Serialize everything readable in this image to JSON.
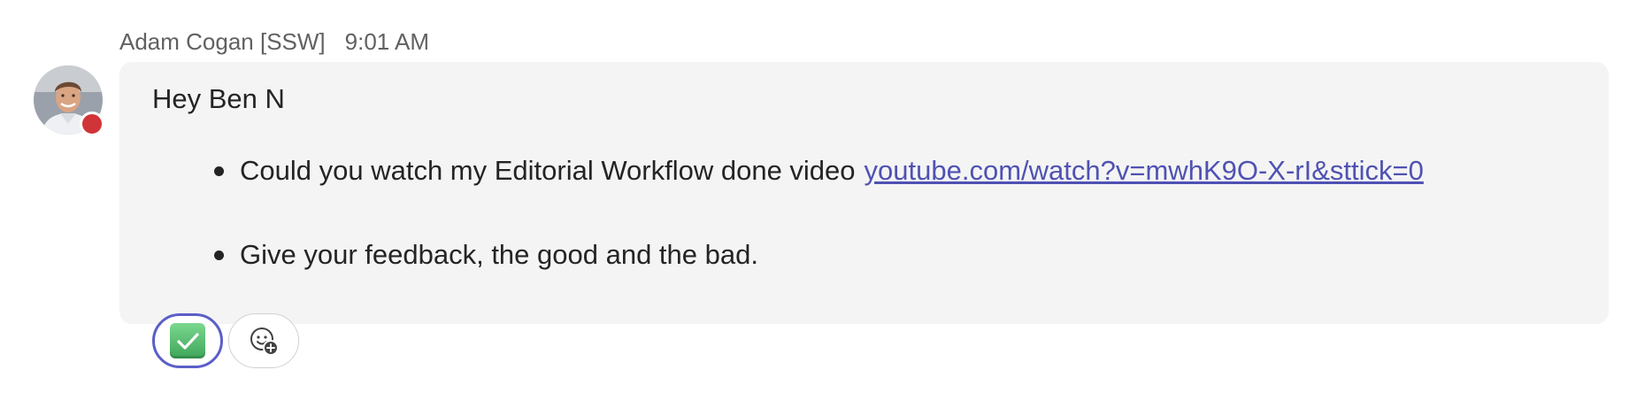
{
  "message": {
    "author": "Adam Cogan [SSW]",
    "time": "9:01 AM",
    "greeting": "Hey Ben N",
    "bullets": [
      {
        "text": "Could you watch my Editorial Workflow done video",
        "link": "youtube.com/watch?v=mwhK9O-X-rI&sttick=0"
      },
      {
        "text": "Give your feedback, the good and the bad."
      }
    ]
  },
  "avatar": {
    "presence": "busy",
    "presence_color": "#d13438"
  },
  "reactions": [
    {
      "icon": "check-mark-button-icon",
      "selected": true
    },
    {
      "icon": "add-reaction-icon",
      "selected": false
    }
  ],
  "colors": {
    "bubble_background": "#f4f4f4",
    "link": "#4f52b2",
    "selected_reaction_border": "#5b5fc7"
  }
}
